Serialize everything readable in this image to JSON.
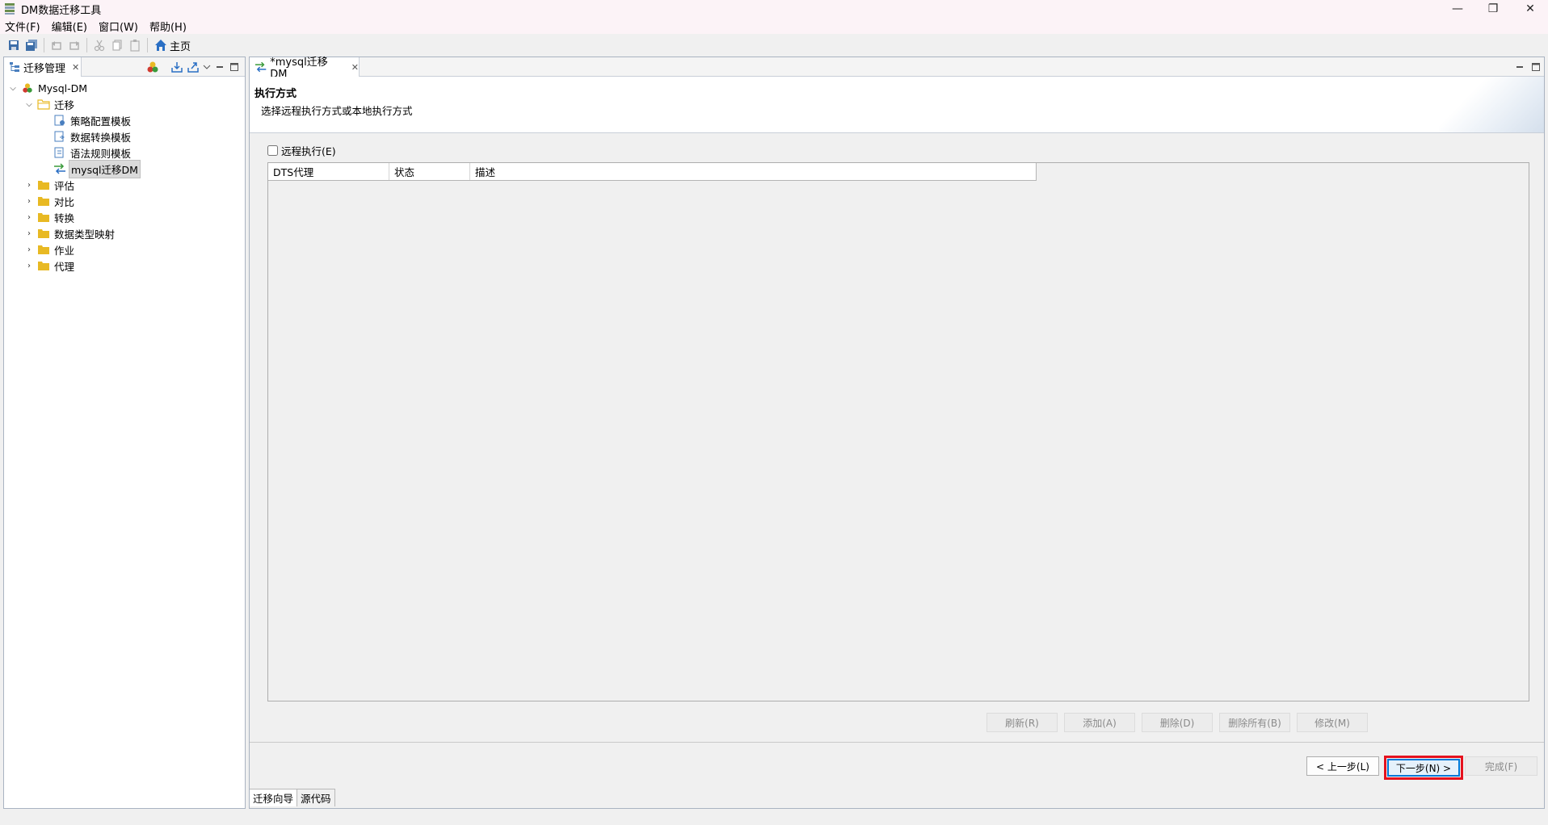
{
  "window": {
    "title": "DM数据迁移工具",
    "controls": {
      "minimize": "—",
      "restore": "❐",
      "close": "✕"
    }
  },
  "menu": [
    "文件(F)",
    "编辑(E)",
    "窗口(W)",
    "帮助(H)"
  ],
  "toolbar": {
    "home_label": "主页"
  },
  "left_panel": {
    "tab_label": "迁移管理",
    "tree": {
      "root": "Mysql-DM",
      "migration_folder": "迁移",
      "migration_items": [
        "策略配置模板",
        "数据转换模板",
        "语法规则模板",
        "mysql迁移DM"
      ],
      "folders": [
        "评估",
        "对比",
        "转换",
        "数据类型映射",
        "作业",
        "代理"
      ]
    }
  },
  "editor": {
    "tab_label": "*mysql迁移DM",
    "header_title": "执行方式",
    "header_desc": "选择远程执行方式或本地执行方式",
    "remote_checkbox_label": "远程执行(E)",
    "table_columns": [
      "DTS代理",
      "状态",
      "描述"
    ],
    "action_buttons": [
      "刷新(R)",
      "添加(A)",
      "删除(D)",
      "删除所有(B)",
      "修改(M)"
    ],
    "nav_buttons": {
      "back": "< 上一步(L)",
      "next": "下一步(N) >",
      "finish": "完成(F)"
    },
    "bottom_tabs": [
      "迁移向导",
      "源代码"
    ]
  },
  "colors": {
    "highlight_frame": "#e5121e",
    "focus_border": "#0078d7",
    "folder": "#e8b923"
  }
}
